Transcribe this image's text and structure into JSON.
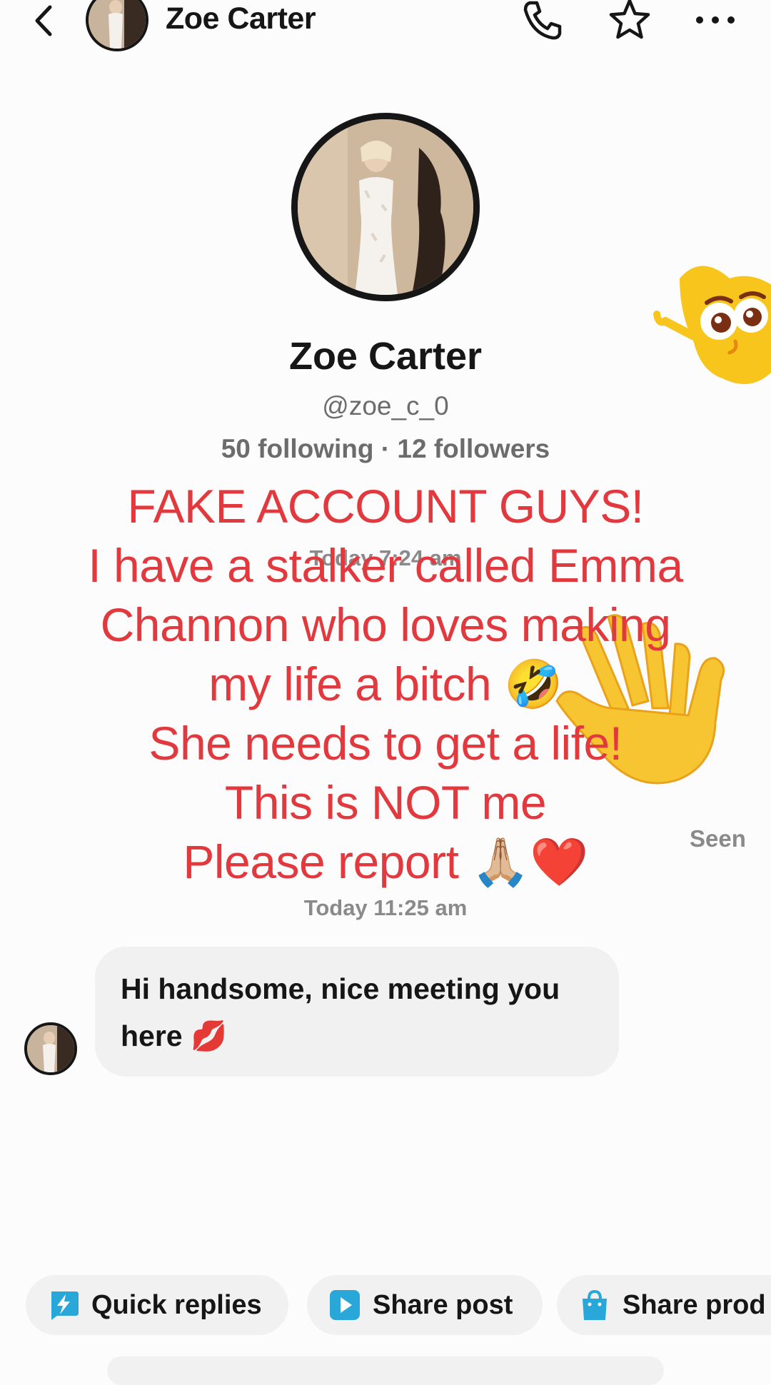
{
  "header": {
    "contact_name": "Zoe Carter"
  },
  "profile": {
    "name": "Zoe Carter",
    "handle": "@zoe_c_0",
    "stats": "50 following · 12 followers"
  },
  "timestamps": {
    "first": "Today 7:24 am",
    "second": "Today 11:25 am"
  },
  "status": {
    "seen": "Seen"
  },
  "caption": {
    "lines": [
      "FAKE ACCOUNT GUYS!",
      "I have a stalker called Emma",
      "Channon who loves making",
      "my life a bitch 🤣",
      "She needs to get a life!",
      "This is NOT me",
      "Please report 🙏🏼❤️"
    ]
  },
  "messages": [
    {
      "from": "Zoe Carter",
      "text": "Hi handsome, nice meeting you here 💋"
    }
  ],
  "quick_actions": [
    {
      "label": "Quick replies",
      "icon": "lightning-icon"
    },
    {
      "label": "Share post",
      "icon": "play-icon"
    },
    {
      "label": "Share prod",
      "icon": "shopping-bag-icon"
    }
  ],
  "colors": {
    "caption": "#e2393f",
    "accent": "#2aa7d9",
    "bubble": "#f1f1f1"
  }
}
